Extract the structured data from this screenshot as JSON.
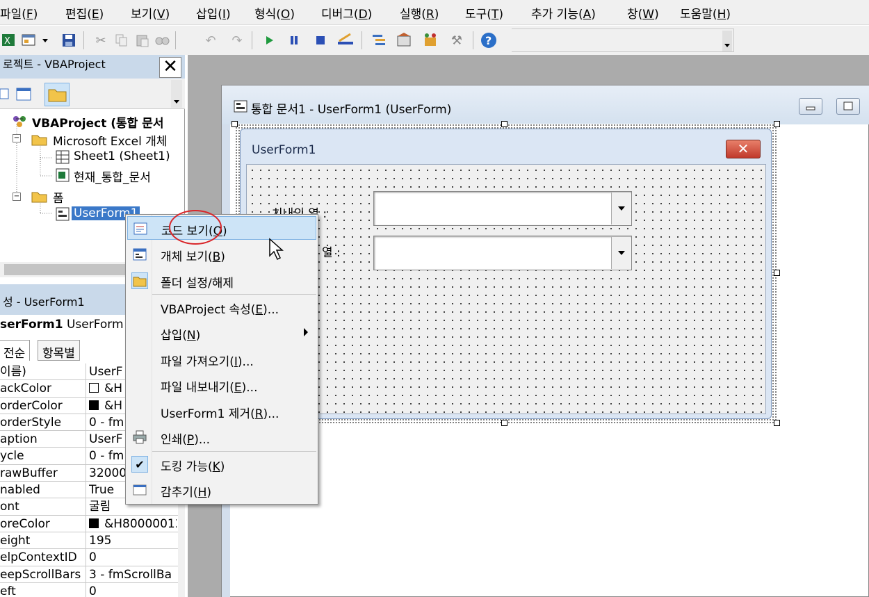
{
  "menubar": {
    "items": [
      {
        "label": "파일(",
        "key": "F",
        "rest": ")"
      },
      {
        "label": "편집(",
        "key": "E",
        "rest": ")"
      },
      {
        "label": "보기(",
        "key": "V",
        "rest": ")"
      },
      {
        "label": "삽입(",
        "key": "I",
        "rest": ")"
      },
      {
        "label": "형식(",
        "key": "O",
        "rest": ")"
      },
      {
        "label": "디버그(",
        "key": "D",
        "rest": ")"
      },
      {
        "label": "실행(",
        "key": "R",
        "rest": ")"
      },
      {
        "label": "도구(",
        "key": "T",
        "rest": ")"
      },
      {
        "label": "추가 기능(",
        "key": "A",
        "rest": ")"
      },
      {
        "label": "창(",
        "key": "W",
        "rest": ")"
      },
      {
        "label": "도움말(",
        "key": "H",
        "rest": ")"
      }
    ]
  },
  "project": {
    "title": "로젝트 - VBAProject",
    "close": "✕",
    "tree": {
      "root": "VBAProject (통합 문서",
      "excel_objects": "Microsoft Excel 개체",
      "sheet1": "Sheet1 (Sheet1)",
      "workbook": "현재_통합_문서",
      "forms": "폼",
      "userform": "UserForm1"
    }
  },
  "properties": {
    "title": "성 - UserForm1",
    "object_name": "serForm1",
    "object_type": " UserForm",
    "tabs": [
      "전순",
      "항목별"
    ],
    "rows": [
      {
        "name": "이름)",
        "value": "UserF"
      },
      {
        "name": "ackColor",
        "value": "&H",
        "swatch": "#ffffff"
      },
      {
        "name": "orderColor",
        "value": "&H",
        "swatch": "#000000"
      },
      {
        "name": "orderStyle",
        "value": "0 - fm"
      },
      {
        "name": "aption",
        "value": "UserF"
      },
      {
        "name": "ycle",
        "value": "0 - fm"
      },
      {
        "name": "rawBuffer",
        "value": "32000"
      },
      {
        "name": "nabled",
        "value": "True"
      },
      {
        "name": "ont",
        "value": "굴림"
      },
      {
        "name": "oreColor",
        "value": "&H80000012",
        "swatch": "#000000"
      },
      {
        "name": "eight",
        "value": "195"
      },
      {
        "name": "elpContextID",
        "value": "0"
      },
      {
        "name": "eepScrollBars",
        "value": "3 - fmScrollBa"
      },
      {
        "name": "eft",
        "value": "0"
      }
    ]
  },
  "designer": {
    "title": "통합 문서1 - UserForm1 (UserForm)"
  },
  "userform": {
    "caption": "UserForm1",
    "close": "✕",
    "label1": "치내의 열 :",
    "label2": "열 :"
  },
  "context_menu": {
    "items": [
      {
        "id": "view-code",
        "label": "코드 보기(",
        "key": "O",
        "rest": ")",
        "active": true
      },
      {
        "id": "view-object",
        "label": "개체 보기(",
        "key": "B",
        "rest": ")"
      },
      {
        "id": "toggle-folders",
        "label": "폴더 설정/해제",
        "key": "",
        "rest": ""
      },
      {
        "id": "project-properties",
        "label": "VBAProject 속성(",
        "key": "E",
        "rest": ")..."
      },
      {
        "id": "insert",
        "label": "삽입(",
        "key": "N",
        "rest": ")",
        "submenu": true
      },
      {
        "id": "import-file",
        "label": "파일 가져오기(",
        "key": "I",
        "rest": ")..."
      },
      {
        "id": "export-file",
        "label": "파일 내보내기(",
        "key": "E",
        "rest": ")..."
      },
      {
        "id": "remove-userform",
        "label": "UserForm1 제거(",
        "key": "R",
        "rest": ")..."
      },
      {
        "id": "print",
        "label": "인쇄(",
        "key": "P",
        "rest": ")..."
      },
      {
        "id": "dockable",
        "label": "도킹 가능(",
        "key": "K",
        "rest": ")",
        "checked": true
      },
      {
        "id": "hide",
        "label": "감추기(",
        "key": "H",
        "rest": ")"
      }
    ]
  },
  "colors": {
    "highlight": "#cde4f7",
    "annotation": "#d9262a",
    "selection": "#3a78c8"
  }
}
